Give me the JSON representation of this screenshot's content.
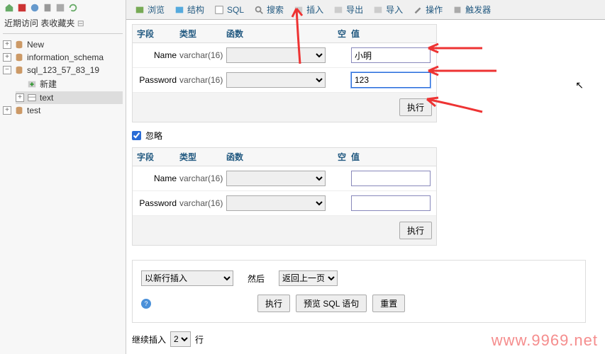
{
  "sidebar": {
    "recent_label": "近期访问",
    "fav_label": "表收藏夹",
    "nodes": [
      {
        "label": "New",
        "expand": "+"
      },
      {
        "label": "information_schema",
        "expand": "+"
      },
      {
        "label": "sql_123_57_83_19",
        "expand": "−",
        "children": [
          {
            "label": "新建",
            "icon": "new"
          },
          {
            "label": "text",
            "selected": true,
            "expand": "+"
          }
        ]
      },
      {
        "label": "test",
        "expand": "+"
      }
    ]
  },
  "toolbar": [
    {
      "icon": "browse",
      "label": "浏览"
    },
    {
      "icon": "struct",
      "label": "结构"
    },
    {
      "icon": "sql",
      "label": "SQL"
    },
    {
      "icon": "search",
      "label": "搜索"
    },
    {
      "icon": "insert",
      "label": "插入"
    },
    {
      "icon": "export",
      "label": "导出"
    },
    {
      "icon": "import",
      "label": "导入"
    },
    {
      "icon": "ops",
      "label": "操作"
    },
    {
      "icon": "trigger",
      "label": "触发器"
    }
  ],
  "table_headers": {
    "field": "字段",
    "type": "类型",
    "func": "函数",
    "null": "空",
    "value": "值"
  },
  "form1": {
    "rows": [
      {
        "field": "Name",
        "type": "varchar(16)",
        "value": "小明"
      },
      {
        "field": "Password",
        "type": "varchar(16)",
        "value": "123",
        "focused": true
      }
    ],
    "execute": "执行"
  },
  "ignore": {
    "checked": true,
    "label": "忽略"
  },
  "form2": {
    "rows": [
      {
        "field": "Name",
        "type": "varchar(16)",
        "value": ""
      },
      {
        "field": "Password",
        "type": "varchar(16)",
        "value": ""
      }
    ],
    "execute": "执行"
  },
  "bottom": {
    "insert_as": "以新行插入",
    "then_label": "然后",
    "then_value": "返回上一页",
    "execute": "执行",
    "preview": "预览 SQL 语句",
    "reset": "重置"
  },
  "footer": {
    "continue_label": "继续插入",
    "count": "2",
    "rows": "行"
  },
  "watermark": "www.9969.net"
}
